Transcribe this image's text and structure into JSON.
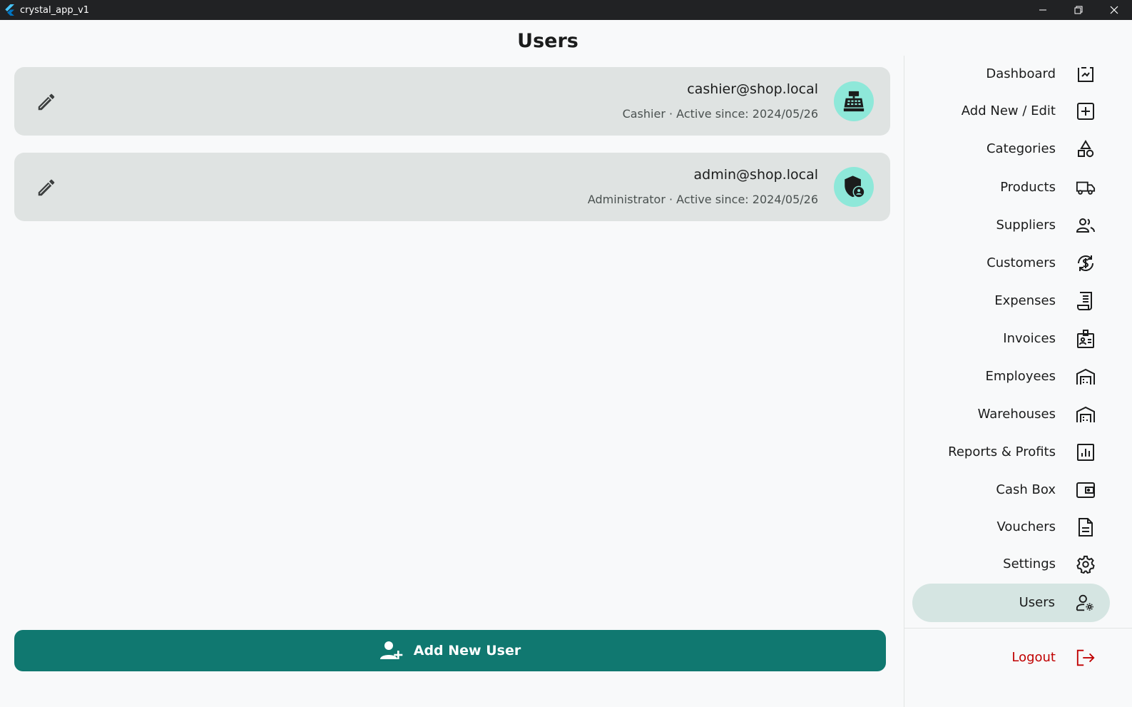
{
  "window": {
    "title": "crystal_app_v1"
  },
  "page": {
    "title": "Users"
  },
  "users": [
    {
      "email": "cashier@shop.local",
      "subtitle": "Cashier · Active since: 2024/05/26",
      "icon": "cash-register-icon"
    },
    {
      "email": "admin@shop.local",
      "subtitle": "Administrator · Active since: 2024/05/26",
      "icon": "admin-shield-icon"
    }
  ],
  "add_user_button": {
    "label": "Add New User",
    "icon": "person-add-icon"
  },
  "sidebar": {
    "items": [
      {
        "label": "Dashboard",
        "icon": "dashboard-icon"
      },
      {
        "label": "Add New / Edit",
        "icon": "add-box-icon"
      },
      {
        "label": "Categories",
        "icon": "categories-icon"
      },
      {
        "label": "Products",
        "icon": "truck-icon"
      },
      {
        "label": "Suppliers",
        "icon": "people-icon"
      },
      {
        "label": "Customers",
        "icon": "currency-exchange-icon"
      },
      {
        "label": "Expenses",
        "icon": "receipt-icon"
      },
      {
        "label": "Invoices",
        "icon": "badge-icon"
      },
      {
        "label": "Employees",
        "icon": "warehouse-icon"
      },
      {
        "label": "Warehouses",
        "icon": "warehouse-icon"
      },
      {
        "label": "Reports & Profits",
        "icon": "bar-chart-icon"
      },
      {
        "label": "Cash Box",
        "icon": "wallet-icon"
      },
      {
        "label": "Vouchers",
        "icon": "document-icon"
      },
      {
        "label": "Settings",
        "icon": "gear-icon"
      },
      {
        "label": "Users",
        "icon": "manage-accounts-icon",
        "active": true
      }
    ],
    "logout": {
      "label": "Logout",
      "icon": "logout-icon"
    }
  },
  "colors": {
    "primary": "#107870",
    "avatar_bg": "#8ee8d9",
    "card_bg": "#dfe3e2",
    "active_nav_bg": "#d5e5e2",
    "logout": "#c00000"
  }
}
